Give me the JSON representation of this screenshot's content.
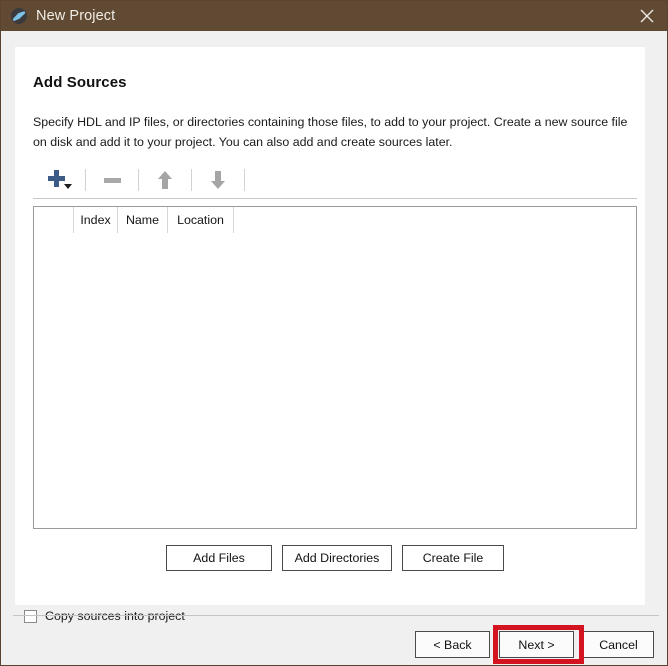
{
  "window": {
    "title": "New Project",
    "icon": "vivado-logo-icon",
    "close_icon": "close-icon",
    "titlebar_color": "#604a33"
  },
  "page": {
    "heading": "Add Sources",
    "description": "Specify HDL and IP files, or directories containing those files, to add to your project. Create a new source file on disk and add it to your project. You can also add and create sources later."
  },
  "toolbar": {
    "add_icon": "plus-dropdown-icon",
    "remove_icon": "minus-icon",
    "move_up_icon": "arrow-up-icon",
    "move_down_icon": "arrow-down-icon"
  },
  "sources_table": {
    "columns": [
      "",
      "Index",
      "Name",
      "Location"
    ],
    "rows": []
  },
  "mid_buttons": {
    "add_files": "Add Files",
    "add_directories": "Add Directories",
    "create_file": "Create File"
  },
  "options": {
    "copy_sources_label": "Copy sources into project",
    "copy_sources_checked": false
  },
  "footer": {
    "back": "< Back",
    "next": "Next >",
    "cancel": "Cancel",
    "highlight_color": "#d3131f"
  }
}
